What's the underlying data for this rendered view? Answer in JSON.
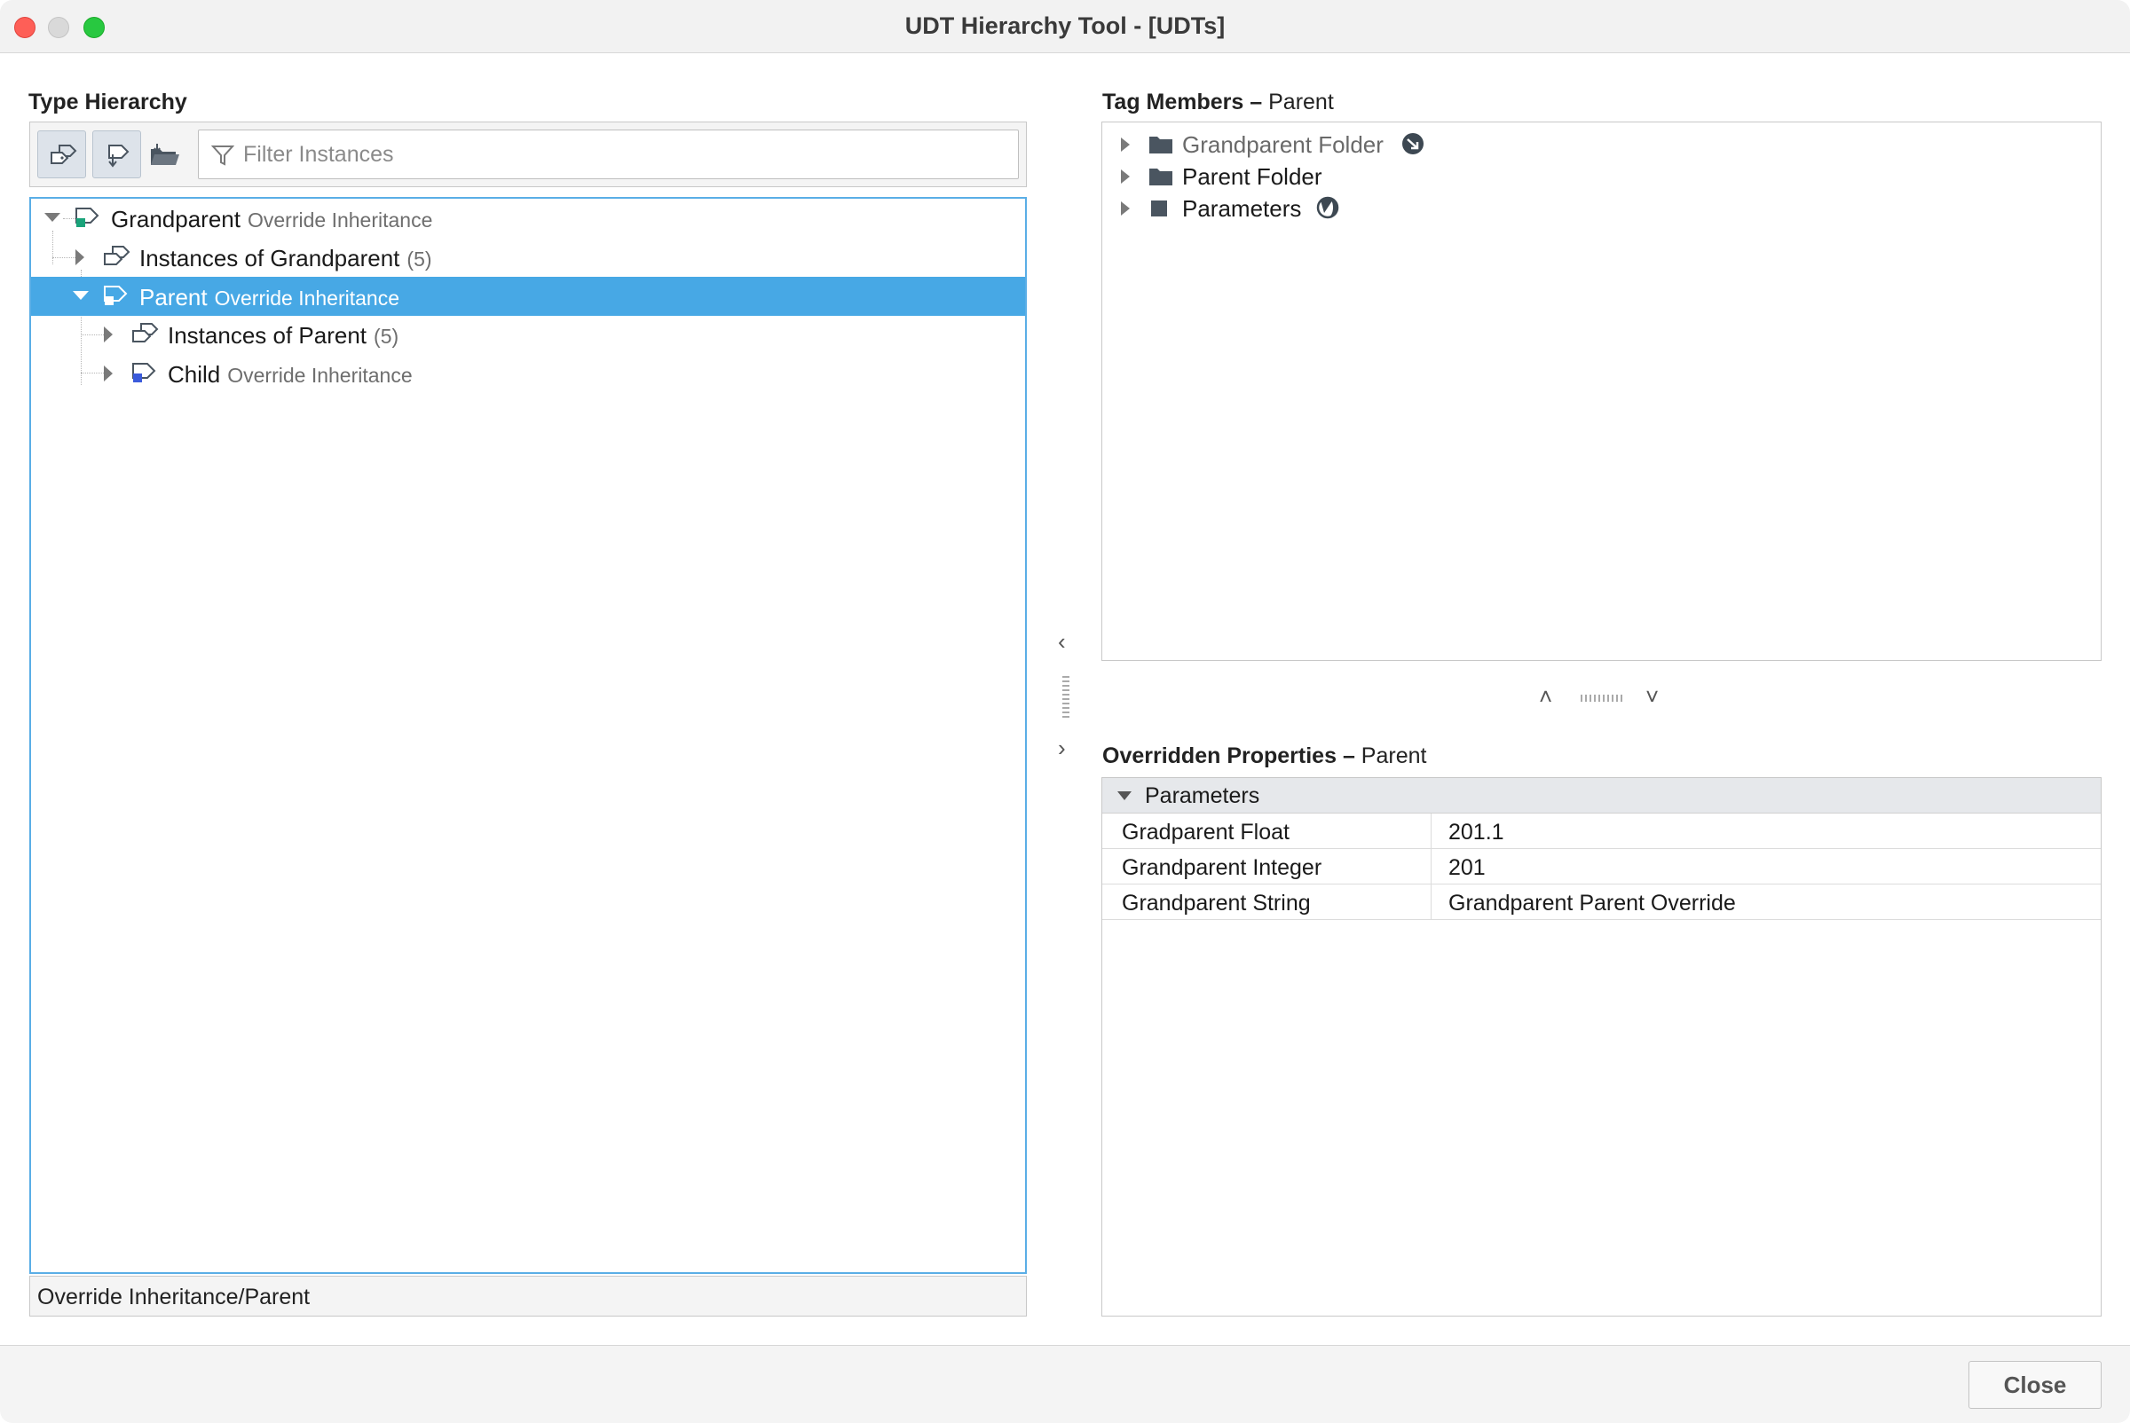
{
  "window": {
    "title": "UDT Hierarchy Tool - [UDTs]"
  },
  "left": {
    "heading": "Type Hierarchy",
    "filter_placeholder": "Filter Instances",
    "toolbar_icons": [
      "show-instances-icon",
      "show-types-icon",
      "folder-sort-icon"
    ],
    "tree": [
      {
        "name": "Grandparent",
        "meta": "Override Inheritance",
        "icon": "udt-definition-icon",
        "expanded": true,
        "level": 0
      },
      {
        "name": "Instances of Grandparent",
        "meta": "(5)",
        "icon": "udt-instances-icon",
        "expanded": false,
        "level": 1
      },
      {
        "name": "Parent",
        "meta": "Override Inheritance",
        "icon": "udt-definition-icon",
        "expanded": true,
        "level": 1,
        "selected": true
      },
      {
        "name": "Instances of Parent",
        "meta": "(5)",
        "icon": "udt-instances-icon",
        "expanded": false,
        "level": 2
      },
      {
        "name": "Child",
        "meta": "Override Inheritance",
        "icon": "udt-definition-icon",
        "expanded": false,
        "level": 2
      }
    ],
    "status_path": "Override Inheritance/Parent"
  },
  "members": {
    "heading": "Tag Members",
    "heading_sep": "–",
    "heading_sub": "Parent",
    "items": [
      {
        "name": "Grandparent Folder",
        "icon": "folder-icon",
        "badge": "inherited-override-icon",
        "muted": true
      },
      {
        "name": "Parent Folder",
        "icon": "folder-icon",
        "muted": false
      },
      {
        "name": "Parameters",
        "icon": "parameters-icon",
        "badge": "partial-override-icon",
        "muted": false
      }
    ]
  },
  "props": {
    "heading": "Overridden Properties",
    "heading_sep": "–",
    "heading_sub": "Parent",
    "group": "Parameters",
    "rows": [
      {
        "key": "Gradparent Float",
        "value": "201.1"
      },
      {
        "key": "Grandparent Integer",
        "value": "201"
      },
      {
        "key": "Grandparent String",
        "value": "Grandparent Parent Override"
      }
    ]
  },
  "splitter": {
    "collapse_left": "‹",
    "expand_right": "›",
    "up": "˄",
    "down": "˅"
  },
  "footer": {
    "close_label": "Close"
  },
  "colors": {
    "selection": "#47a8e5",
    "tree_border": "#5aaee6",
    "grandparent_badge": "#1aa37a",
    "child_badge": "#3b5bdb"
  }
}
